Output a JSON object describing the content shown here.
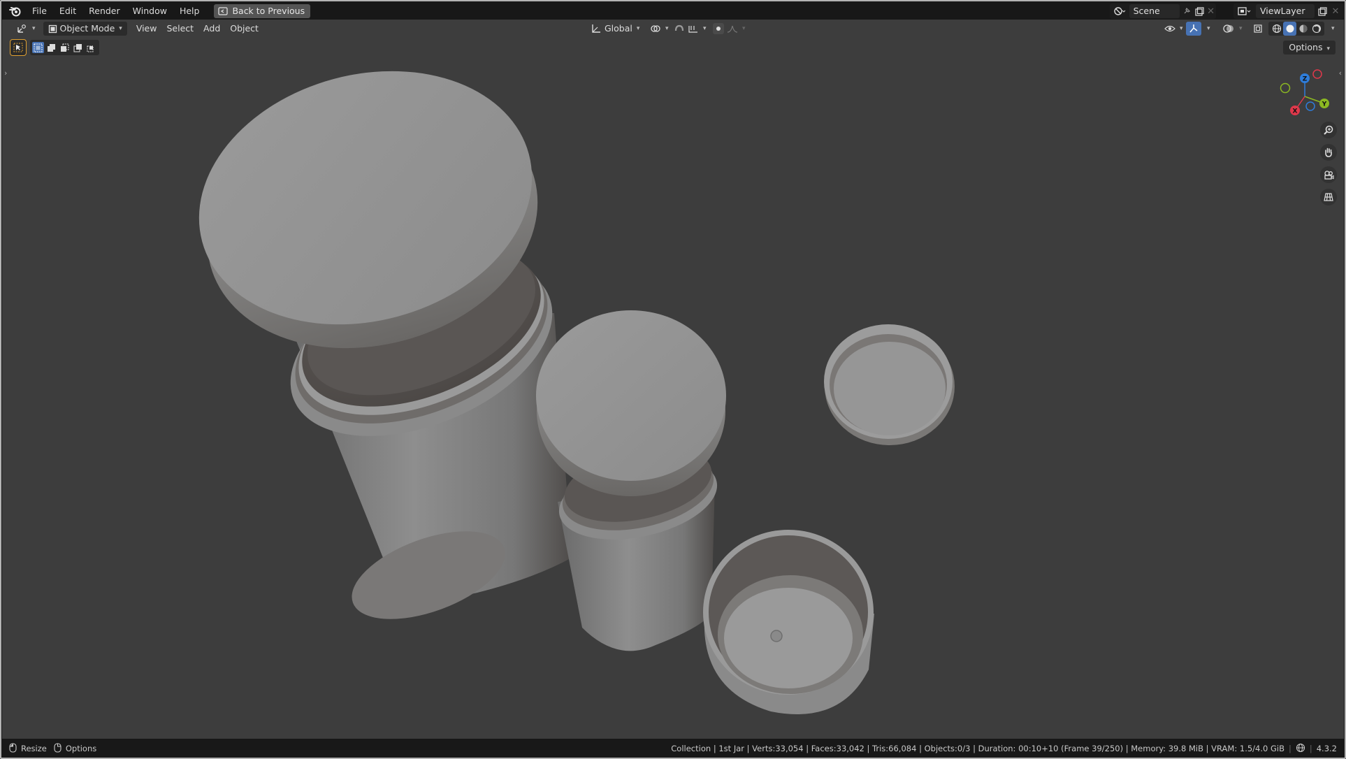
{
  "menu": {
    "items": [
      "File",
      "Edit",
      "Render",
      "Window",
      "Help"
    ],
    "back_button": "Back to Previous"
  },
  "top_right": {
    "scene": "Scene",
    "view_layer": "ViewLayer"
  },
  "viewport_header": {
    "mode": "Object Mode",
    "menus": [
      "View",
      "Select",
      "Add",
      "Object"
    ],
    "orientation": "Global",
    "options_label": "Options"
  },
  "gizmo": {
    "x_label": "X",
    "y_label": "Y",
    "z_label": "Z",
    "x_color": "#e0384b",
    "y_color": "#8cb922",
    "z_color": "#2e7ddb"
  },
  "statusbar": {
    "left": [
      "Resize",
      "Options"
    ],
    "info": "Collection | 1st Jar | Verts:33,054 | Faces:33,042 | Tris:66,084 | Objects:0/3 | Duration: 00:10+10 (Frame 39/250) | Memory: 39.8 MiB | VRAM: 1.5/4.0 GiB",
    "version": "4.3.2"
  },
  "icons": [
    "blender-logo-icon",
    "back-icon",
    "editor-type-icon",
    "object-mode-icon",
    "transform-orientation-icon",
    "pivot-icon",
    "snap-icon",
    "proportional-icon",
    "visibility-icon",
    "gizmo-icon",
    "overlay-icon",
    "xray-icon",
    "wireframe-shading-icon",
    "solid-shading-icon",
    "material-shading-icon",
    "rendered-shading-icon",
    "zoom-icon",
    "hand-icon",
    "camera-icon",
    "grid-icon",
    "select-tool-icon"
  ]
}
